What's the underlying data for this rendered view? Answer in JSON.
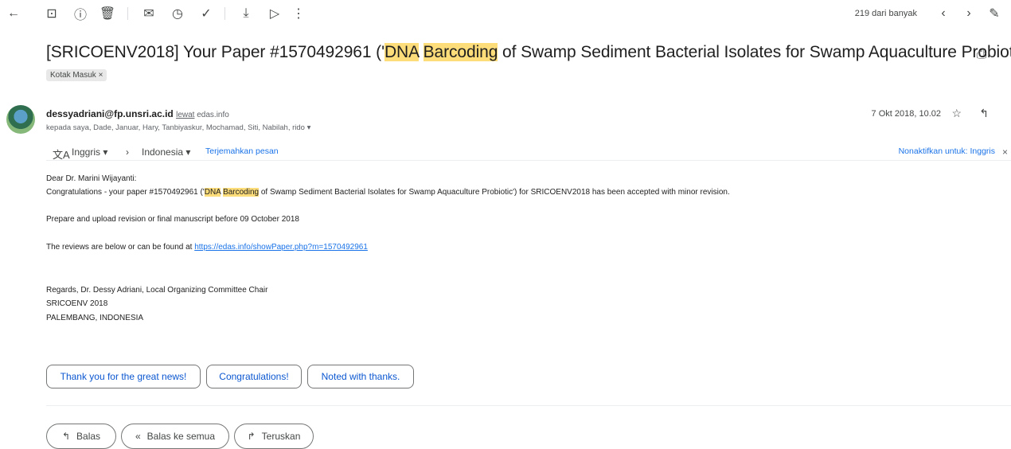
{
  "toolbar": {
    "back": "←",
    "archive": "⊡",
    "report": "ⓘ",
    "delete": "🗑",
    "mark_unread": "✉",
    "snooze": "◷",
    "add_task": "✓",
    "move": "⤓",
    "label": "▷",
    "more": "⋮",
    "pager": "219 dari banyak",
    "prev": "‹",
    "next": "›",
    "edit": "✎"
  },
  "subject": {
    "pre": "[SRICOENV2018] Your Paper #1570492961 ('",
    "hl1": "DNA",
    "hl2": "Barcoding",
    "post": " of Swamp Sediment Bacterial Isolates for Swamp Aquaculture Probiotic')",
    "print": "⎙",
    "label_chip": "Kotak Masuk ×"
  },
  "sender": {
    "email": "dessyadriani@fp.unsri.ac.id",
    "via": "lewat",
    "via_domain": "edas.info",
    "recipients": "kepada saya, Dade, Januar, Hary, Tanbiyaskur, Mochamad, Siti, Nabilah, rido ▾",
    "date": "7 Okt 2018, 10.02",
    "star": "☆",
    "reply_icon": "↰"
  },
  "translate": {
    "icon": "文A",
    "from": "Inggris ▾",
    "arrow": "›",
    "to": "Indonesia ▾",
    "action": "Terjemahkan pesan",
    "disable": "Nonaktifkan untuk: Inggris",
    "close": "×"
  },
  "body": {
    "greeting": "Dear Dr. Marini Wijayanti:",
    "l2_pre": "Congratulations - your paper #1570492961 ('",
    "l2_hl1": "DNA",
    "l2_hl2": "Barcoding",
    "l2_post": " of Swamp Sediment Bacterial Isolates for Swamp Aquaculture Probiotic') for SRICOENV2018 has been accepted with minor revision.",
    "l3": "Prepare and upload revision or final manuscript before 09 October 2018",
    "l4_pre": "The reviews are below or can be found at ",
    "l4_link": "https://edas.info/showPaper.php?m=1570492961",
    "sig1": "Regards, Dr. Dessy Adriani, Local Organizing Committee Chair",
    "sig2": "SRICOENV 2018",
    "sig3": "PALEMBANG, INDONESIA"
  },
  "smart_replies": [
    "Thank you for the great news!",
    "Congratulations!",
    "Noted with thanks."
  ],
  "actions": {
    "reply": "Balas",
    "reply_icon": "↰",
    "reply_all": "Balas ke semua",
    "reply_all_icon": "«",
    "forward": "Teruskan",
    "forward_icon": "↱"
  }
}
